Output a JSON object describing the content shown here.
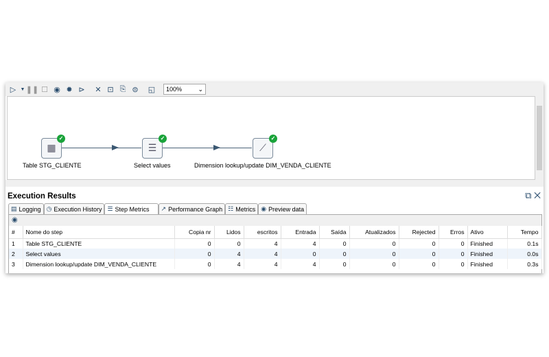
{
  "toolbar": {
    "icons": [
      "run-icon",
      "dropdown-icon",
      "pause-icon",
      "stop-icon",
      "preview-icon",
      "debug-icon",
      "replay-icon",
      "verify-icon",
      "impact-icon",
      "sql-icon",
      "explore-db-icon",
      "grid-icon"
    ],
    "zoom": "100%"
  },
  "canvas": {
    "steps": [
      {
        "label": "Table STG_CLIENTE",
        "status": "ok"
      },
      {
        "label": "Select values",
        "status": "ok"
      },
      {
        "label": "Dimension lookup/update DIM_VENDA_CLIENTE",
        "status": "ok"
      }
    ]
  },
  "results": {
    "title": "Execution Results",
    "tabs": [
      {
        "label": "Logging",
        "icon": "log-icon"
      },
      {
        "label": "Execution History",
        "icon": "history-icon"
      },
      {
        "label": "Step Metrics",
        "icon": "metrics-list-icon"
      },
      {
        "label": "Performance Graph",
        "icon": "graph-icon"
      },
      {
        "label": "Metrics",
        "icon": "metrics-icon"
      },
      {
        "label": "Preview data",
        "icon": "eye-icon"
      }
    ],
    "active_tab": "Step Metrics",
    "columns": [
      "#",
      "Nome do step",
      "Copia nr",
      "Lidos",
      "escritos",
      "Entrada",
      "Saída",
      "Atualizados",
      "Rejected",
      "Erros",
      "Ativo",
      "Tempo"
    ],
    "rows": [
      [
        "1",
        "Table STG_CLIENTE",
        "0",
        "0",
        "4",
        "4",
        "0",
        "0",
        "0",
        "0",
        "Finished",
        "0.1s"
      ],
      [
        "2",
        "Select values",
        "0",
        "4",
        "4",
        "0",
        "0",
        "0",
        "0",
        "0",
        "Finished",
        "0.0s"
      ],
      [
        "3",
        "Dimension lookup/update DIM_VENDA_CLIENTE",
        "0",
        "4",
        "4",
        "4",
        "0",
        "0",
        "0",
        "0",
        "Finished",
        "0.3s"
      ]
    ]
  },
  "colors": {
    "success": "#1aa33a",
    "icon": "#2a4d6e",
    "row_alt": "#eef4fb"
  }
}
